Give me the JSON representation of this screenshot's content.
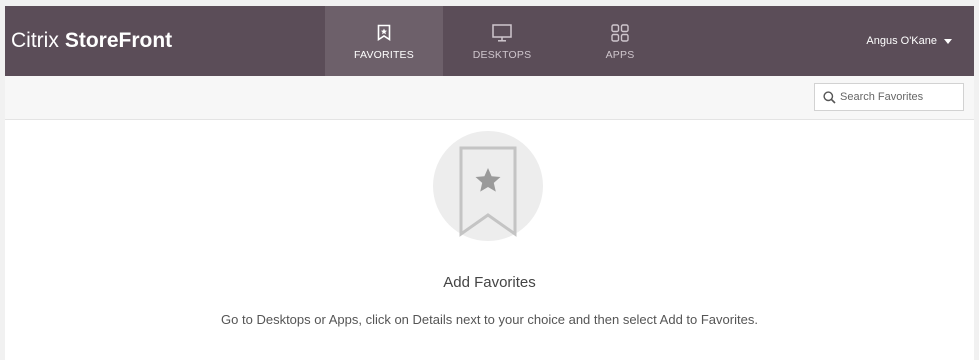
{
  "header": {
    "brand_light": "Citrix",
    "brand_bold": "StoreFront",
    "tabs": [
      {
        "label": "FAVORITES",
        "icon": "bookmark-star-icon",
        "active": true
      },
      {
        "label": "DESKTOPS",
        "icon": "monitor-icon",
        "active": false
      },
      {
        "label": "APPS",
        "icon": "apps-grid-icon",
        "active": false
      }
    ],
    "user_name": "Angus O'Kane",
    "background_color": "#5b4d58",
    "active_tab_color": "#6d606a"
  },
  "toolbar": {
    "search_placeholder": "Search Favorites"
  },
  "empty_state": {
    "icon": "bookmark-star-icon",
    "title": "Add Favorites",
    "message": "Go to Desktops or Apps, click on Details next to your choice and then select Add to Favorites."
  }
}
